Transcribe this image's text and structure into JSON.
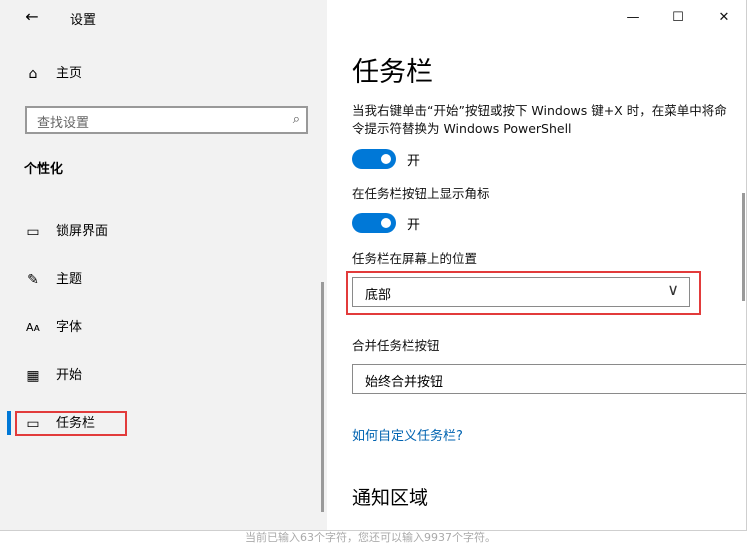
{
  "window": {
    "title": "设置"
  },
  "caption": {
    "minimize_icon": "—",
    "maximize_icon": "☐",
    "close_icon": "✕"
  },
  "sidebar": {
    "back_icon": "←",
    "home": {
      "label": "主页",
      "icon": "⌂"
    },
    "search": {
      "placeholder": "查找设置",
      "icon": "⌕"
    },
    "section": "个性化",
    "items": [
      {
        "label": "锁屏界面",
        "icon": "▭"
      },
      {
        "label": "主题",
        "icon": "✎"
      },
      {
        "label": "字体",
        "icon": "Aᴀ"
      },
      {
        "label": "开始",
        "icon": "▦"
      },
      {
        "label": "任务栏",
        "icon": "▭",
        "active": true
      }
    ]
  },
  "main": {
    "title": "任务栏",
    "powershell": {
      "text": "当我右键单击“开始”按钮或按下 Windows 键+X 时，在菜单中将命令提示符替换为 Windows PowerShell",
      "state": "开",
      "on": true
    },
    "badges": {
      "text": "在任务栏按钮上显示角标",
      "state": "开",
      "on": true
    },
    "position": {
      "label": "任务栏在屏幕上的位置",
      "value": "底部",
      "chevron": "∨"
    },
    "combine": {
      "label": "合并任务栏按钮",
      "value": "始终合并按钮"
    },
    "link": "如何自定义任务栏?",
    "notification_title": "通知区域"
  },
  "footer": {
    "text": "当前已输入63个字符，您还可以输入9937个字符。"
  },
  "colors": {
    "accent": "#0078d7",
    "highlight": "#e23b3b",
    "link": "#0063b1"
  }
}
